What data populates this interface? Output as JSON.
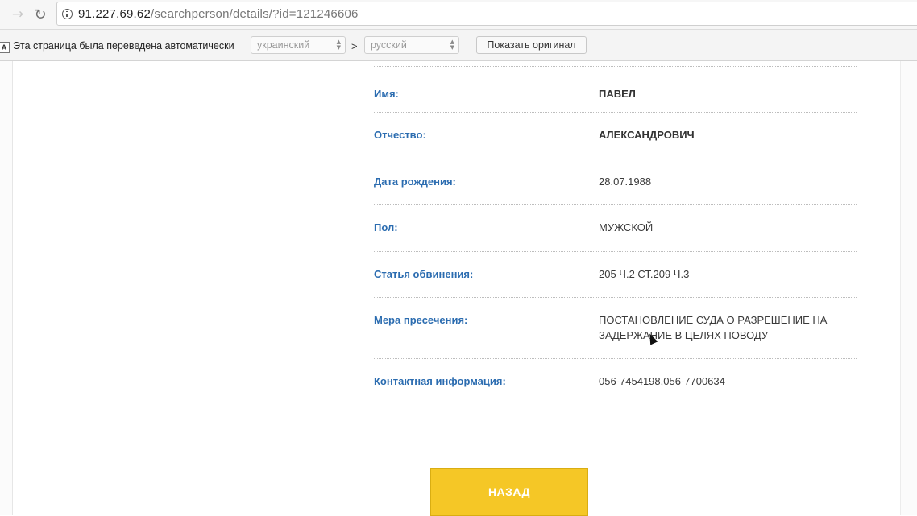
{
  "browser": {
    "url_host": "91.227.69.62",
    "url_path": "/searchperson/details/?id=121246606"
  },
  "translate_bar": {
    "message": "Эта страница была переведена автоматически",
    "from_language": "украинский",
    "to_language": "русский",
    "separator": ">",
    "show_original_label": "Показать оригинал"
  },
  "details": {
    "rows": [
      {
        "label": "Имя:",
        "value": "ПАВЕЛ"
      },
      {
        "label": "Отчество:",
        "value": "АЛЕКСАНДРОВИЧ"
      },
      {
        "label": "Дата рождения:",
        "value": "28.07.1988"
      },
      {
        "label": "Пол:",
        "value": "МУЖСКОЙ"
      },
      {
        "label": "Статья обвинения:",
        "value": "205 Ч.2 СТ.209 Ч.3"
      },
      {
        "label": "Мера пресечения:",
        "value": "ПОСТАНОВЛЕНИЕ СУДА О РАЗРЕШЕНИЕ НА ЗАДЕРЖАНИЕ В ЦЕЛЯХ ПОВОДУ"
      },
      {
        "label": "Контактная информация:",
        "value": "056-7454198,056-7700634"
      }
    ]
  },
  "back_button_label": "НАЗАД",
  "colors": {
    "label_blue": "#2b6cb0",
    "button_yellow": "#f5c726"
  },
  "icons": {
    "forward": "arrow-right-icon",
    "reload": "reload-icon",
    "info": "info-icon",
    "translate": "translate-icon"
  }
}
